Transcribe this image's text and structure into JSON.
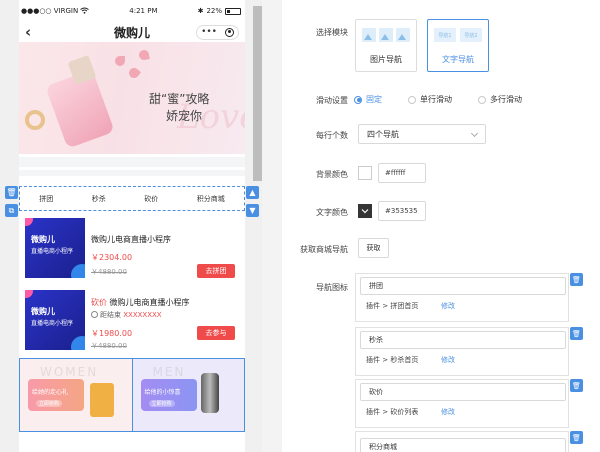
{
  "status_bar": {
    "carrier": "●●●○○ VIRGIN",
    "wifi_icon": "wifi-icon",
    "time": "4:21 PM",
    "bluetooth": "✱",
    "battery": "22%"
  },
  "nav_bar": {
    "title": "微购儿",
    "back_icon": "chevron-left-icon",
    "more_icon": "more-dots-icon",
    "close_icon": "target-icon"
  },
  "banner": {
    "line1": "甜“蜜”攻略",
    "line2": "娇宠你",
    "script": "Love"
  },
  "tab_nav": {
    "items": [
      "拼团",
      "秒杀",
      "砍价",
      "积分商城"
    ]
  },
  "products": [
    {
      "thumb_title": "微购儿",
      "thumb_sub": "直播电商小程序",
      "title": "微购儿电商直播小程序",
      "price": "￥2304.00",
      "old_price": "￥4880.00",
      "button": "去拼团"
    },
    {
      "thumb_title": "微购儿",
      "thumb_sub": "直播电商小程序",
      "tag": "砍价",
      "title": "微购儿电商直播小程序",
      "countdown_label": "距结束",
      "countdown_value": "XXXXXXXX",
      "price": "￥1980.00",
      "old_price": "￥4880.00",
      "button": "去参与"
    }
  ],
  "cards": [
    {
      "watermark": "WOMEN",
      "pill_text": "给她的走心礼",
      "pill_sub": "立即抢购"
    },
    {
      "watermark": "MEN",
      "pill_text": "给他的小惊喜",
      "pill_sub": "立即抢购"
    }
  ],
  "side_controls": {
    "delete_icon": "trash-icon",
    "copy_icon": "copy-icon",
    "up_icon": "chevron-up-icon",
    "down_icon": "chevron-down-icon"
  },
  "settings": {
    "module_label": "选择模块",
    "modules": [
      {
        "name": "图片导航",
        "active": false
      },
      {
        "name": "文字导航",
        "active": true,
        "preview": [
          "导航1",
          "导航2"
        ]
      }
    ],
    "scroll_label": "滑动设置",
    "scroll_options": [
      {
        "label": "固定",
        "checked": true
      },
      {
        "label": "单行滑动",
        "checked": false
      },
      {
        "label": "多行滑动",
        "checked": false
      }
    ],
    "per_row_label": "每行个数",
    "per_row_value": "四个导航",
    "bg_label": "背景颜色",
    "bg_value": "#ffffff",
    "text_color_label": "文字颜色",
    "text_color_value": "#353535",
    "fetch_label": "获取商城导航",
    "fetch_button": "获取",
    "icon_label": "导航图标",
    "nav_items": [
      {
        "name": "拼团",
        "link": "插件 > 拼团首页",
        "edit": "修改"
      },
      {
        "name": "秒杀",
        "link": "插件 > 秒杀首页",
        "edit": "修改"
      },
      {
        "name": "砍价",
        "link": "插件 > 砍价列表",
        "edit": "修改"
      },
      {
        "name": "积分商城",
        "link": "",
        "edit": ""
      }
    ]
  },
  "colors": {
    "accent": "#4a90e2",
    "price": "#f04b4b",
    "text_color_swatch": "#353535"
  }
}
